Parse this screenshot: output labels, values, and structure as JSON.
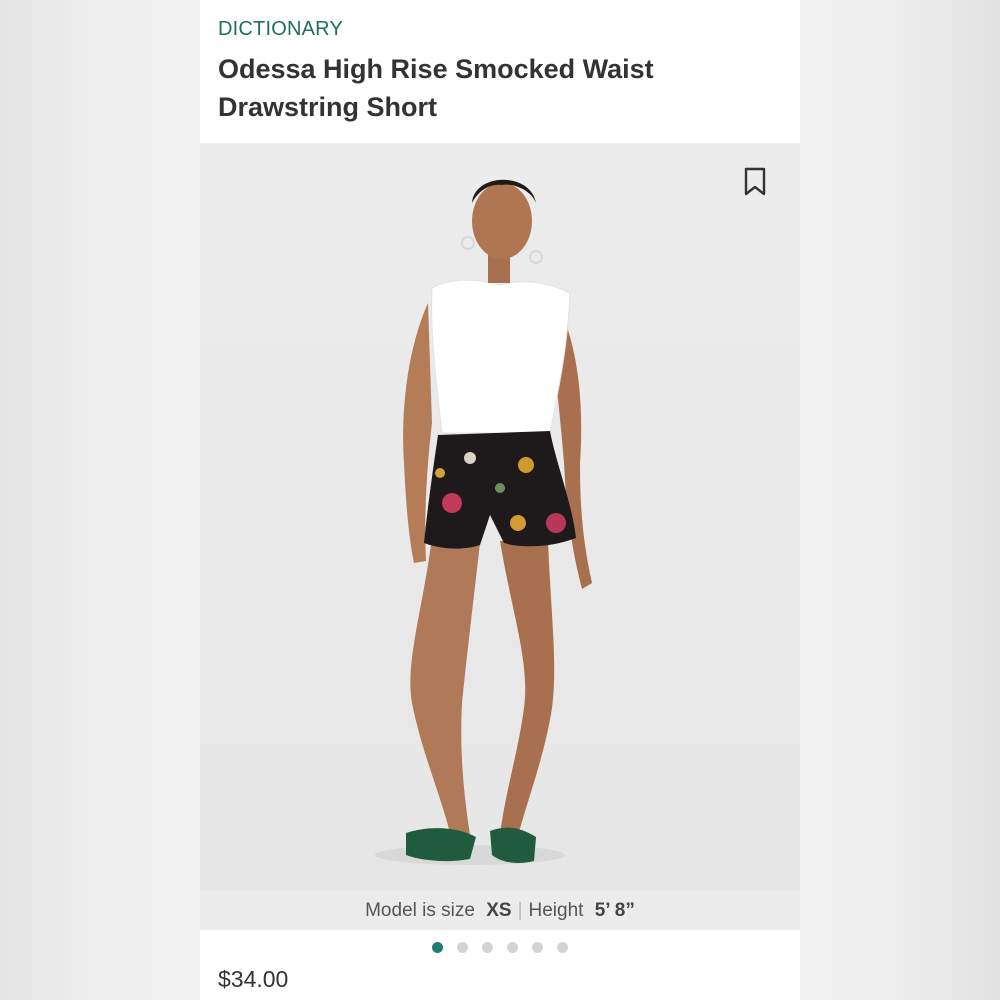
{
  "product": {
    "brand": "DICTIONARY",
    "title": "Odessa High Rise Smocked Waist Drawstring Short",
    "price": "$34.00"
  },
  "photo": {
    "bookmark_icon": "bookmark-icon"
  },
  "caption": {
    "model_prefix": "Model is size",
    "model_size": "XS",
    "height_prefix": "Height",
    "height_value": "5’ 8”"
  },
  "carousel": {
    "count": 6,
    "active_index": 0
  },
  "colors": {
    "accent": "#1f7d71",
    "brand_text": "#1f6e5f",
    "dot_inactive": "#d3d3d3"
  }
}
